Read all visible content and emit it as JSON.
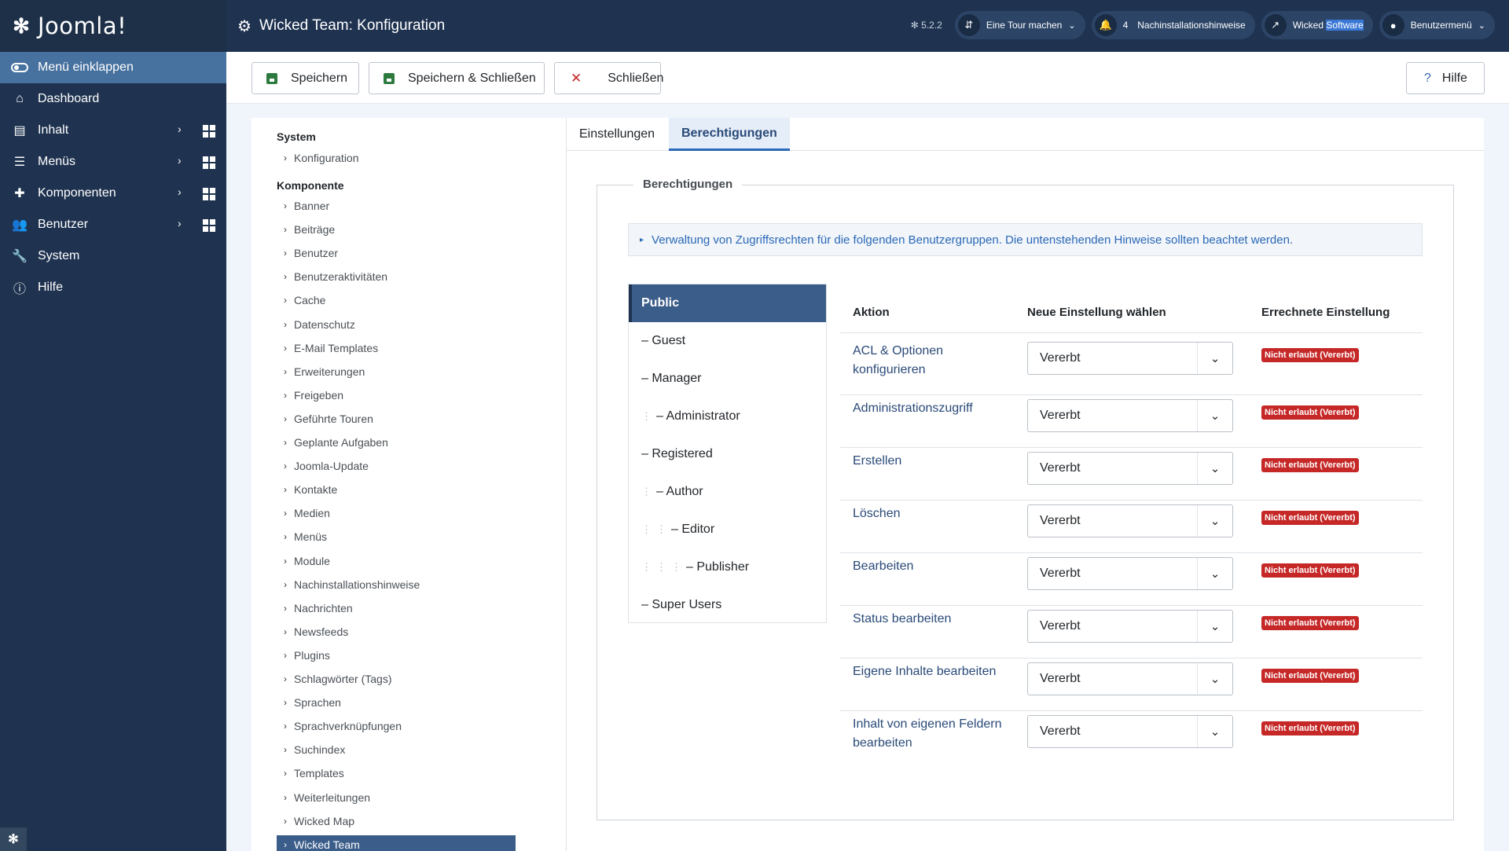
{
  "app": {
    "name": "Joomla!",
    "version": "5.2.2"
  },
  "sidebar": {
    "collapse_label": "Menü einklappen",
    "items": [
      {
        "label": "Dashboard",
        "icon": "home-icon"
      },
      {
        "label": "Inhalt",
        "icon": "file-icon"
      },
      {
        "label": "Menüs",
        "icon": "list-icon"
      },
      {
        "label": "Komponenten",
        "icon": "puzzle-icon"
      },
      {
        "label": "Benutzer",
        "icon": "users-icon"
      },
      {
        "label": "System",
        "icon": "wrench-icon"
      },
      {
        "label": "Hilfe",
        "icon": "info-icon"
      }
    ]
  },
  "header": {
    "title": "Wicked Team: Konfiguration",
    "tour_label": "Eine Tour machen",
    "notifications_count": "4",
    "postinstall_label": "Nachinstallationshinweise",
    "site_label_a": "Wicked",
    "site_label_b": "Software",
    "user_menu_label": "Benutzermenü"
  },
  "toolbar": {
    "save_label": "Speichern",
    "save_close_label": "Speichern & Schließen",
    "close_label": "Schließen",
    "help_label": "Hilfe"
  },
  "leftnav": {
    "system_heading": "System",
    "system_items": [
      "Konfiguration"
    ],
    "component_heading": "Komponente",
    "component_items": [
      "Banner",
      "Beiträge",
      "Benutzer",
      "Benutzeraktivitäten",
      "Cache",
      "Datenschutz",
      "E-Mail Templates",
      "Erweiterungen",
      "Freigeben",
      "Geführte Touren",
      "Geplante Aufgaben",
      "Joomla-Update",
      "Kontakte",
      "Medien",
      "Menüs",
      "Module",
      "Nachinstallationshinweise",
      "Nachrichten",
      "Newsfeeds",
      "Plugins",
      "Schlagwörter (Tags)",
      "Sprachen",
      "Sprachverknüpfungen",
      "Suchindex",
      "Templates",
      "Weiterleitungen",
      "Wicked Map",
      "Wicked Team"
    ],
    "active_item": "Wicked Team"
  },
  "tabs": {
    "settings": "Einstellungen",
    "permissions": "Berechtigungen"
  },
  "permissions": {
    "legend": "Berechtigungen",
    "notice": "Verwaltung von Zugriffsrechten für die folgenden Benutzergruppen. Die untenstehenden Hinweise sollten beachtet werden.",
    "groups": [
      {
        "label": "Public",
        "level": 0
      },
      {
        "label": "– Guest",
        "level": 0
      },
      {
        "label": "– Manager",
        "level": 0
      },
      {
        "label": "– Administrator",
        "level": 1
      },
      {
        "label": "– Registered",
        "level": 0
      },
      {
        "label": "– Author",
        "level": 1
      },
      {
        "label": "– Editor",
        "level": 2
      },
      {
        "label": "– Publisher",
        "level": 3
      },
      {
        "label": "– Super Users",
        "level": 0
      }
    ],
    "headers": {
      "action": "Aktion",
      "new_setting": "Neue Einstellung wählen",
      "calculated": "Errechnete Einstellung"
    },
    "rows": [
      {
        "action": "ACL & Optionen konfigurieren",
        "value": "Vererbt",
        "calculated": "Nicht erlaubt (Vererbt)"
      },
      {
        "action": "Administrationszugriff",
        "value": "Vererbt",
        "calculated": "Nicht erlaubt (Vererbt)"
      },
      {
        "action": "Erstellen",
        "value": "Vererbt",
        "calculated": "Nicht erlaubt (Vererbt)"
      },
      {
        "action": "Löschen",
        "value": "Vererbt",
        "calculated": "Nicht erlaubt (Vererbt)"
      },
      {
        "action": "Bearbeiten",
        "value": "Vererbt",
        "calculated": "Nicht erlaubt (Vererbt)"
      },
      {
        "action": "Status bearbeiten",
        "value": "Vererbt",
        "calculated": "Nicht erlaubt (Vererbt)"
      },
      {
        "action": "Eigene Inhalte bearbeiten",
        "value": "Vererbt",
        "calculated": "Nicht erlaubt (Vererbt)"
      },
      {
        "action": "Inhalt von eigenen Feldern bearbeiten",
        "value": "Vererbt",
        "calculated": "Nicht erlaubt (Vererbt)"
      }
    ]
  },
  "colors": {
    "sidebar_bg": "#1f3350",
    "accent": "#3b5d8a",
    "danger": "#c52827",
    "link": "#2a4a78"
  }
}
